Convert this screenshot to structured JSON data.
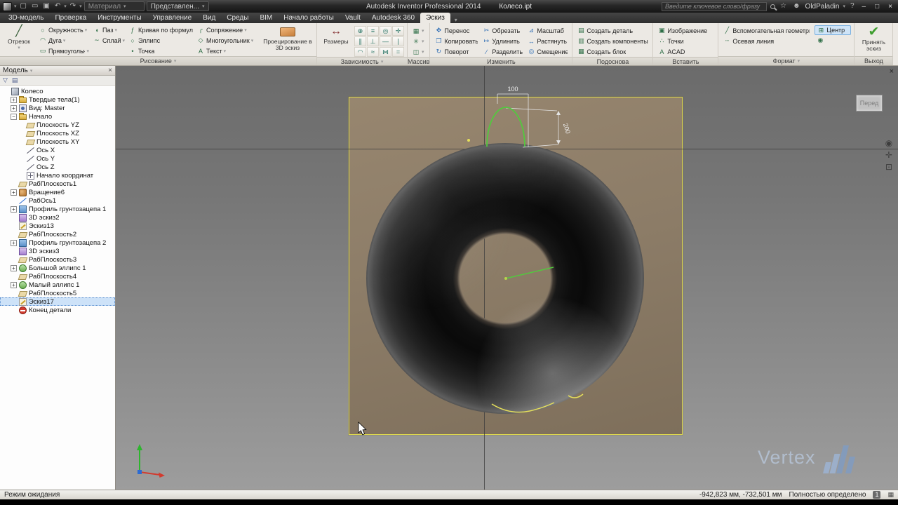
{
  "titlebar": {
    "app_title": "Autodesk Inventor Professional 2014",
    "doc_title": "Колесо.ipt",
    "material": "Материал",
    "appearance": "Представлен...",
    "search_placeholder": "Введите ключевое слово/фразу",
    "user": "OldPaladin",
    "window": {
      "minimize": "–",
      "maximize": "□",
      "close": "×"
    }
  },
  "tabs": {
    "active_index": 10,
    "items": [
      "3D-модель",
      "Проверка",
      "Инструменты",
      "Управление",
      "Вид",
      "Среды",
      "BIM",
      "Начало работы",
      "Vault",
      "Autodesk 360",
      "Эскиз"
    ]
  },
  "ribbon": {
    "draw": {
      "label": "Рисование",
      "line": {
        "label": "Отрезок",
        "glyph": "╱"
      },
      "project": {
        "label": "Проецирование в 3D эскиз"
      },
      "cols": [
        [
          {
            "label": "Окружность",
            "icon": "circle-icon",
            "glyph": "○",
            "dd": true
          },
          {
            "label": "Дуга",
            "icon": "arc-icon",
            "glyph": "◠",
            "dd": true
          },
          {
            "label": "Прямоугольник",
            "icon": "rectangle-icon",
            "glyph": "▭",
            "dd": true
          }
        ],
        [
          {
            "label": "Паз",
            "icon": "slot-icon",
            "glyph": "◖",
            "dd": true
          },
          {
            "label": "Сплайн",
            "icon": "spline-icon",
            "glyph": "∼",
            "dd": true
          },
          {
            "label": ""
          }
        ],
        [
          {
            "label": "Кривая по формуле",
            "icon": "equation-curve-icon",
            "glyph": "ƒ"
          },
          {
            "label": "Эллипс",
            "icon": "ellipse-icon",
            "glyph": "○"
          },
          {
            "label": "Точка",
            "icon": "point-icon",
            "glyph": "•"
          }
        ],
        [
          {
            "label": "Сопряжение",
            "icon": "fillet-icon",
            "glyph": "╭",
            "dd": true
          },
          {
            "label": "Многоугольник",
            "icon": "polygon-icon",
            "glyph": "◇",
            "dd": true
          },
          {
            "label": "Текст",
            "icon": "text-icon",
            "glyph": "A",
            "dd": true
          }
        ]
      ]
    },
    "constrain": {
      "label": "Зависимость",
      "dimension": {
        "label": "Размеры",
        "glyph": "↔"
      },
      "icons": [
        {
          "name": "coincident-constraint-icon",
          "glyph": "⊕"
        },
        {
          "name": "collinear-constraint-icon",
          "glyph": "≡"
        },
        {
          "name": "concentric-constraint-icon",
          "glyph": "◎"
        },
        {
          "name": "fix-constraint-icon",
          "glyph": "✛"
        },
        {
          "name": "parallel-constraint-icon",
          "glyph": "∥"
        },
        {
          "name": "perpendicular-constraint-icon",
          "glyph": "⊥"
        },
        {
          "name": "horizontal-constraint-icon",
          "glyph": "―"
        },
        {
          "name": "vertical-constraint-icon",
          "glyph": "∣"
        },
        {
          "name": "tangent-constraint-icon",
          "glyph": "◠"
        },
        {
          "name": "smooth-constraint-icon",
          "glyph": "≈"
        },
        {
          "name": "symmetric-constraint-icon",
          "glyph": "⋈"
        },
        {
          "name": "equal-constraint-icon",
          "glyph": "="
        }
      ]
    },
    "pattern": {
      "label": "Массив",
      "icons": [
        {
          "name": "rectangular-pattern-icon",
          "glyph": "▦"
        },
        {
          "name": "circular-pattern-icon",
          "glyph": "✳"
        },
        {
          "name": "mirror-icon",
          "glyph": "◫"
        }
      ]
    },
    "modify": {
      "label": "Изменить",
      "rows": [
        [
          {
            "label": "Перенос",
            "icon": "move-icon",
            "glyph": "✥"
          },
          {
            "label": "Обрезать",
            "icon": "trim-icon",
            "glyph": "✂"
          },
          {
            "label": "Масштаб",
            "icon": "scale-icon",
            "glyph": "⊿"
          }
        ],
        [
          {
            "label": "Копировать",
            "icon": "copy-icon",
            "glyph": "❐"
          },
          {
            "label": "Удлинить",
            "icon": "extend-icon",
            "glyph": "↦"
          },
          {
            "label": "Растянуть",
            "icon": "stretch-icon",
            "glyph": "↔"
          }
        ],
        [
          {
            "label": "Поворот",
            "icon": "rotate-icon",
            "glyph": "↻"
          },
          {
            "label": "Разделить",
            "icon": "split-icon",
            "glyph": "∕"
          },
          {
            "label": "Смещение",
            "icon": "offset-icon",
            "glyph": "◎"
          }
        ]
      ]
    },
    "layout": {
      "label": "Подоснова",
      "items": [
        {
          "label": "Создать деталь",
          "icon": "create-part-icon",
          "glyph": "▤"
        },
        {
          "label": "Создать компоненты",
          "icon": "create-components-icon",
          "glyph": "▥"
        },
        {
          "label": "Создать блок",
          "icon": "create-block-icon",
          "glyph": "▦"
        }
      ]
    },
    "insert": {
      "label": "Вставить",
      "items": [
        {
          "label": "Изображение",
          "icon": "image-icon",
          "glyph": "▣"
        },
        {
          "label": "Точки",
          "icon": "points-icon",
          "glyph": "∴"
        },
        {
          "label": "ACAD",
          "icon": "acad-icon",
          "glyph": "A"
        }
      ]
    },
    "format": {
      "label": "Формат",
      "col1": [
        {
          "label": "Вспомогательная геометрия",
          "icon": "construction-geometry-icon",
          "glyph": "╱"
        },
        {
          "label": "Осевая линия",
          "icon": "centerline-icon",
          "glyph": "┄"
        }
      ],
      "col2": [
        {
          "label": "Центр",
          "icon": "center-icon",
          "glyph": "⊞",
          "highlight": true
        },
        {
          "label": "",
          "icon": "center-point-icon",
          "glyph": "◉"
        }
      ]
    },
    "exit": {
      "label": "Выход",
      "finish": {
        "label": "Принять эскиз",
        "glyph": "✔"
      }
    }
  },
  "browser": {
    "header": "Модель",
    "items": [
      {
        "label": "Колесо",
        "icon": "part",
        "level": 0
      },
      {
        "label": "Твердые тела(1)",
        "icon": "solids-folder",
        "level": 1,
        "exp": "+"
      },
      {
        "label": "Вид: Master",
        "icon": "view",
        "level": 1,
        "exp": "+"
      },
      {
        "label": "Начало",
        "icon": "folder",
        "level": 1,
        "exp": "-"
      },
      {
        "label": "Плоскость YZ",
        "icon": "plane",
        "level": 2
      },
      {
        "label": "Плоскость XZ",
        "icon": "plane",
        "level": 2
      },
      {
        "label": "Плоскость XY",
        "icon": "plane",
        "level": 2
      },
      {
        "label": "Ось X",
        "icon": "axis",
        "level": 2
      },
      {
        "label": "Ось Y",
        "icon": "axis",
        "level": 2
      },
      {
        "label": "Ось Z",
        "icon": "axis",
        "level": 2
      },
      {
        "label": "Начало координат",
        "icon": "origin",
        "level": 2
      },
      {
        "label": "РабПлоскость1",
        "icon": "workplane",
        "level": 1
      },
      {
        "label": "Вращение6",
        "icon": "revolve",
        "level": 1,
        "exp": "+"
      },
      {
        "label": "РабОсь1",
        "icon": "workaxis",
        "level": 1
      },
      {
        "label": "Профиль грунтозацепа 1",
        "icon": "sweep",
        "level": 1,
        "exp": "+"
      },
      {
        "label": "3D эскиз2",
        "icon": "sketch3d",
        "level": 1
      },
      {
        "label": "Эскиз13",
        "icon": "sketch",
        "level": 1
      },
      {
        "label": "РабПлоскость2",
        "icon": "workplane",
        "level": 1
      },
      {
        "label": "Профиль грунтозацепа 2",
        "icon": "sweep",
        "level": 1,
        "exp": "+"
      },
      {
        "label": "3D эскиз3",
        "icon": "sketch3d",
        "level": 1
      },
      {
        "label": "РабПлоскость3",
        "icon": "workplane",
        "level": 1
      },
      {
        "label": "Большой эллипс 1",
        "icon": "loft",
        "level": 1,
        "exp": "+"
      },
      {
        "label": "РабПлоскость4",
        "icon": "workplane",
        "level": 1
      },
      {
        "label": "Малый эллипс 1",
        "icon": "loft",
        "level": 1,
        "exp": "+"
      },
      {
        "label": "РабПлоскость5",
        "icon": "workplane",
        "level": 1
      },
      {
        "label": "Эскиз17",
        "icon": "sketch",
        "level": 1,
        "selected": true
      },
      {
        "label": "Конец детали",
        "icon": "eof",
        "level": 1
      }
    ]
  },
  "viewport": {
    "dims": {
      "d100": "100",
      "d200": "200"
    },
    "viewcube": "Перед",
    "watermark": "Vertex"
  },
  "statusbar": {
    "mode": "Режим ожидания",
    "coords": "-942,823 мм, -732,501 мм",
    "constraint_status": "Полностью определено",
    "dof": "1"
  },
  "colors": {
    "accent_green": "#3f9e2f",
    "sketch_yellow": "#e6e05a",
    "sketch_green": "#52c93e",
    "plane_brown": "#8a7a66",
    "highlight_blue": "#cfe4f7"
  }
}
